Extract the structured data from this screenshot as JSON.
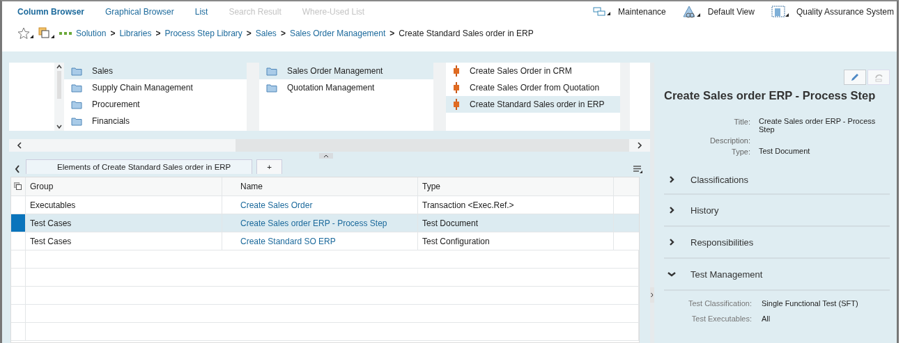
{
  "nav_tabs": [
    {
      "label": "Column Browser",
      "selected": true,
      "disabled": false
    },
    {
      "label": "Graphical Browser",
      "selected": false,
      "disabled": false
    },
    {
      "label": "List",
      "selected": false,
      "disabled": false
    },
    {
      "label": "Search Result",
      "selected": false,
      "disabled": true
    },
    {
      "label": "Where-Used List",
      "selected": false,
      "disabled": true
    }
  ],
  "header_actions": [
    {
      "label": "Maintenance",
      "kind": "maintenance"
    },
    {
      "label": "Default View",
      "kind": "view"
    },
    {
      "label": "Quality Assurance System",
      "kind": "system"
    }
  ],
  "breadcrumb": [
    {
      "label": "Solution",
      "kind": "link"
    },
    {
      "label": ">",
      "kind": "separator"
    },
    {
      "label": "Libraries",
      "kind": "link"
    },
    {
      "label": ">",
      "kind": "separator"
    },
    {
      "label": "Process Step Library",
      "kind": "link"
    },
    {
      "label": ">",
      "kind": "separator"
    },
    {
      "label": "Sales",
      "kind": "link"
    },
    {
      "label": ">",
      "kind": "separator"
    },
    {
      "label": "Sales Order Management",
      "kind": "link"
    },
    {
      "label": ">",
      "kind": "separator"
    },
    {
      "label": "Create Standard Sales order in ERP",
      "kind": "current"
    }
  ],
  "columns": [
    {
      "items": [
        {
          "label": "Sales",
          "kind": "folder",
          "selected": true
        },
        {
          "label": "Supply Chain Management",
          "kind": "folder",
          "selected": false
        },
        {
          "label": "Procurement",
          "kind": "folder",
          "selected": false
        },
        {
          "label": "Financials",
          "kind": "folder",
          "selected": false
        }
      ]
    },
    {
      "items": [
        {
          "label": "Sales Order Management",
          "kind": "folder",
          "selected": true
        },
        {
          "label": "Quotation Management",
          "kind": "folder",
          "selected": false
        }
      ]
    },
    {
      "items": [
        {
          "label": "Create Sales Order in CRM",
          "kind": "step",
          "selected": false
        },
        {
          "label": "Create Sales Order from Quotation",
          "kind": "step",
          "selected": false
        },
        {
          "label": "Create Standard Sales order in ERP",
          "kind": "step",
          "selected": true
        }
      ]
    }
  ],
  "tabs": [
    {
      "label": "Elements of Create Standard Sales order in ERP",
      "selected": true
    },
    {
      "label": "+",
      "selected": false
    }
  ],
  "table": {
    "columns": [
      "Group",
      "Name",
      "Type"
    ],
    "rows": [
      {
        "group": "Executables",
        "name": "Create Sales Order",
        "type": "Transaction <Exec.Ref.>",
        "selected": false
      },
      {
        "group": "Test Cases",
        "name": "Create Sales order ERP - Process Step",
        "type": "Test Document",
        "selected": true
      },
      {
        "group": "Test Cases",
        "name": "Create Standard SO ERP",
        "type": "Test Configuration",
        "selected": false
      }
    ]
  },
  "details": {
    "title": "Create Sales order ERP - Process Step",
    "fields": [
      {
        "label": "Title:",
        "value": "Create Sales order ERP - Process Step"
      },
      {
        "label": "Description:"
      },
      {
        "label": "Type:",
        "value": "Test Document"
      }
    ],
    "sections": [
      {
        "label": "Classifications",
        "expanded": false
      },
      {
        "label": "History",
        "expanded": false
      },
      {
        "label": "Responsibilities",
        "expanded": false
      },
      {
        "label": "Test Management",
        "expanded": true,
        "fields": [
          {
            "label": "Test Classification:",
            "value": "Single Functional Test (SFT)"
          },
          {
            "label": "Test Executables:",
            "value": "All"
          }
        ]
      }
    ]
  }
}
